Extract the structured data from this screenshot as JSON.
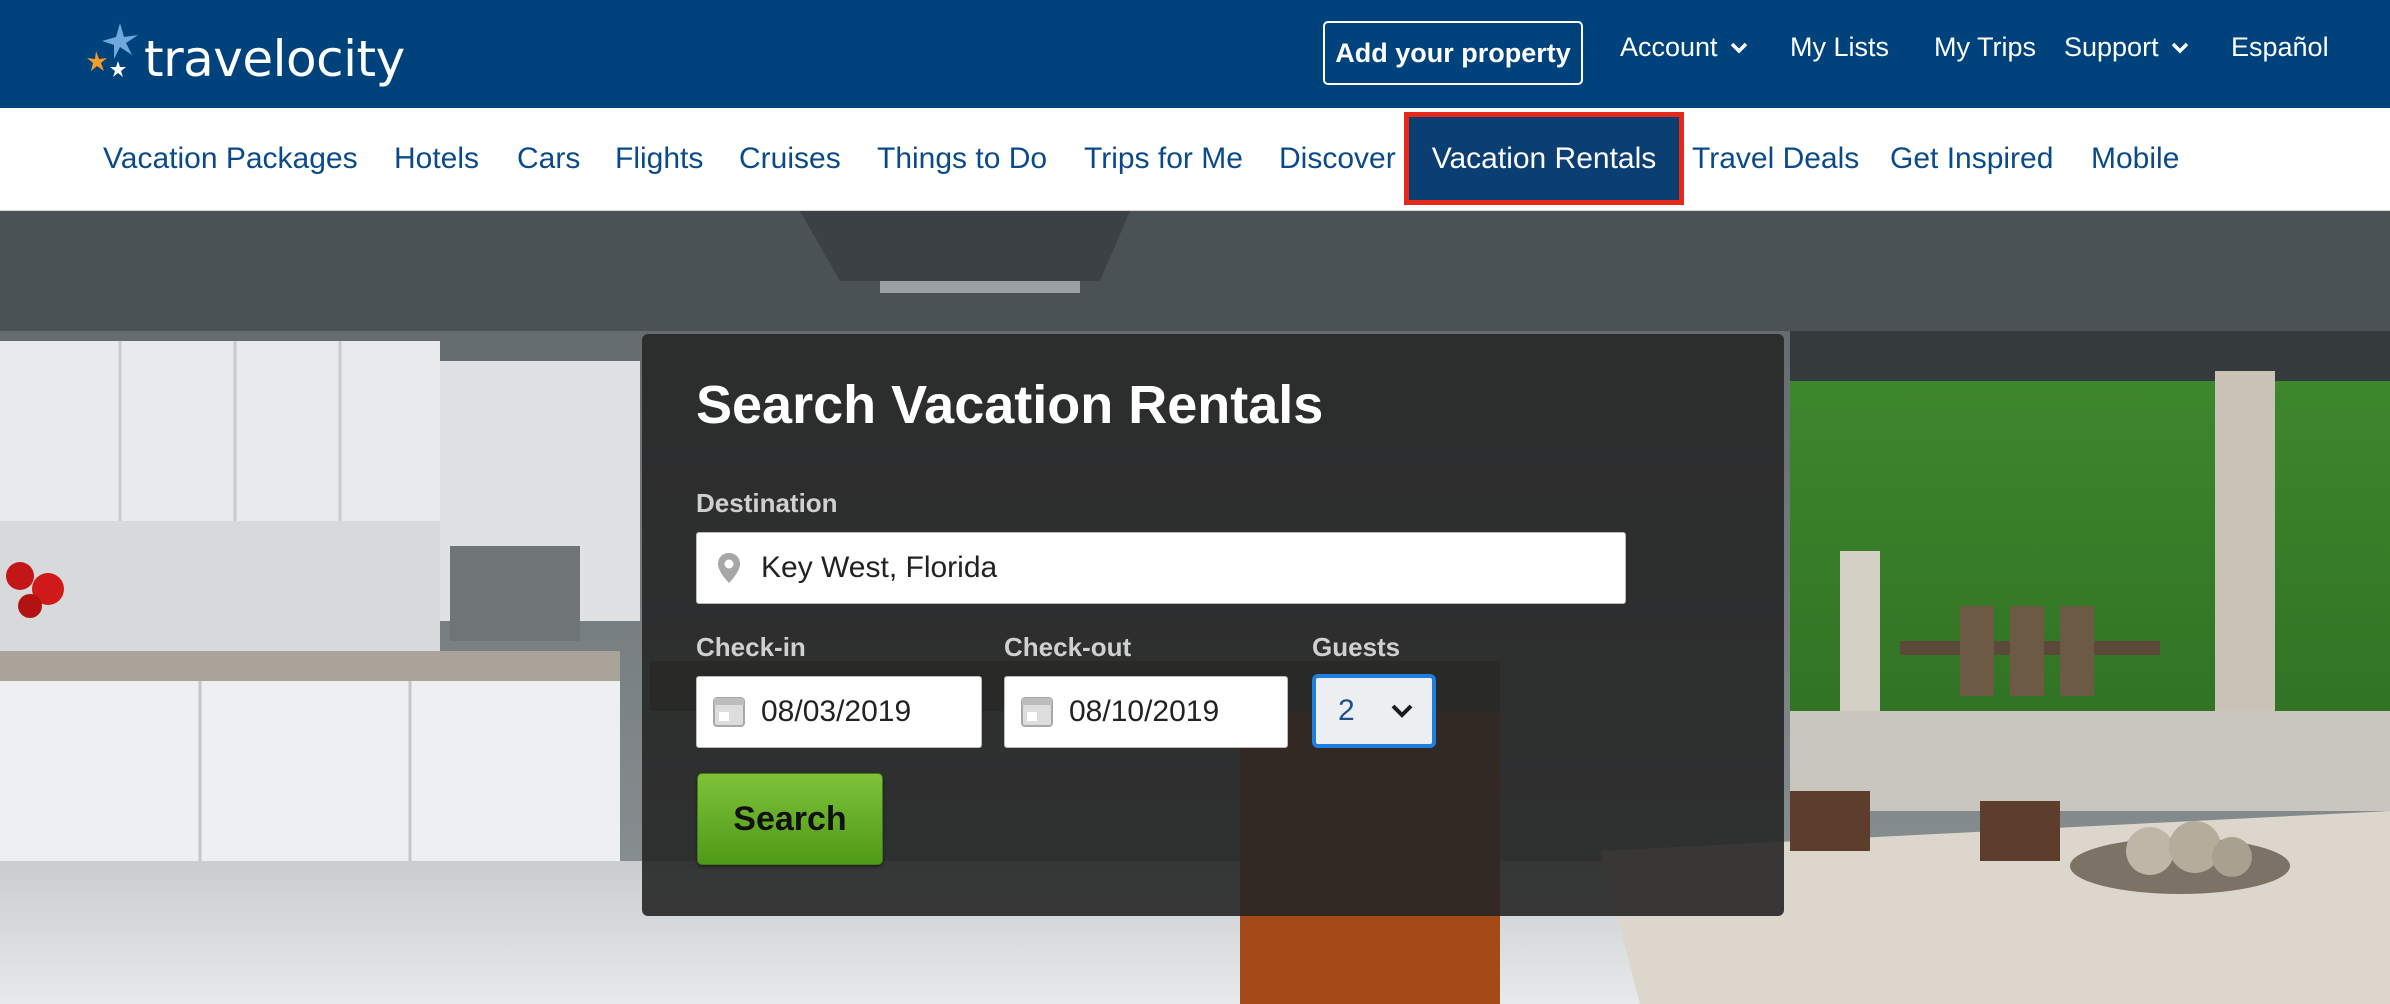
{
  "brand": {
    "logo_text": "travelocity"
  },
  "topbar": {
    "add_property": "Add your property",
    "account": "Account",
    "my_lists": "My Lists",
    "my_trips": "My Trips",
    "support": "Support",
    "espanol": "Español"
  },
  "nav": {
    "items": [
      "Vacation Packages",
      "Hotels",
      "Cars",
      "Flights",
      "Cruises",
      "Things to Do",
      "Trips for Me",
      "Discover",
      "Vacation Rentals",
      "Travel Deals",
      "Get Inspired",
      "Mobile"
    ],
    "active": "Vacation Rentals"
  },
  "search": {
    "title": "Search Vacation Rentals",
    "destination_label": "Destination",
    "destination_value": "Key West, Florida",
    "checkin_label": "Check-in",
    "checkin_value": "08/03/2019",
    "checkout_label": "Check-out",
    "checkout_value": "08/10/2019",
    "guests_label": "Guests",
    "guests_value": "2",
    "search_button": "Search"
  },
  "colors": {
    "topbar": "#00427c",
    "nav_text": "#0a4a8a",
    "highlight_border": "#e8271b",
    "search_button": "#6aaf2a",
    "guests_focus": "#1e7fe0"
  },
  "icons": {
    "destination": "map-pin-icon",
    "date": "calendar-icon",
    "dropdown": "chevron-down-icon"
  }
}
